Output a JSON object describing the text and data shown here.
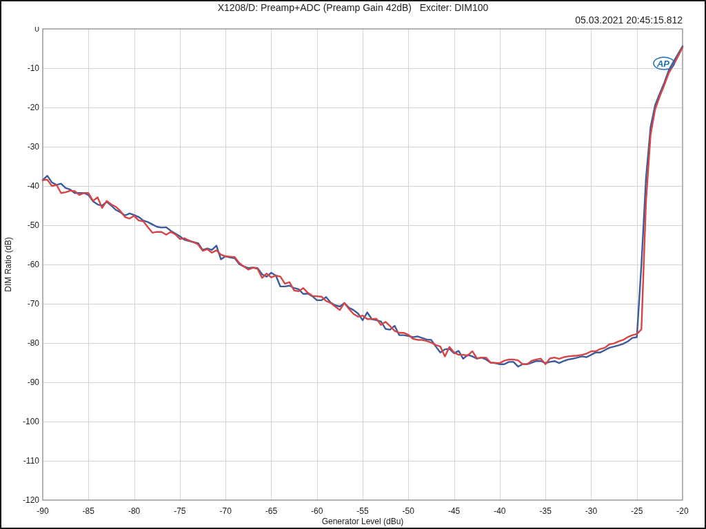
{
  "graph": {
    "timestamp": "05.03.2021 20:45:15.812",
    "logo": "AP",
    "chart_data": {
      "type": "line",
      "grid": true,
      "title": "X1208/D: Preamp+ADC (Preamp Gain 42dB)   Exciter: DIM100",
      "xlabel": "Generator Level (dBu)",
      "ylabel": "DIM Ratio (dB)",
      "x": [
        -90,
        -89.5,
        -89,
        -88.5,
        -88,
        -87.5,
        -87,
        -86.5,
        -86,
        -85.5,
        -85,
        -84.5,
        -84,
        -83.5,
        -83,
        -82.5,
        -82,
        -81.5,
        -81,
        -80.5,
        -80,
        -79.5,
        -79,
        -78.5,
        -78,
        -77.5,
        -77,
        -76.5,
        -76,
        -75.5,
        -75,
        -74.5,
        -74,
        -73.5,
        -73,
        -72.5,
        -72,
        -71.5,
        -71,
        -70.5,
        -70,
        -69.5,
        -69,
        -68.5,
        -68,
        -67.5,
        -67,
        -66.5,
        -66,
        -65.5,
        -65,
        -64.5,
        -64,
        -63.5,
        -63,
        -62.5,
        -62,
        -61.5,
        -61,
        -60.5,
        -60,
        -59.5,
        -59,
        -58.5,
        -58,
        -57.5,
        -57,
        -56.5,
        -56,
        -55.5,
        -55,
        -54.5,
        -54,
        -53.5,
        -53,
        -52.5,
        -52,
        -51.5,
        -51,
        -50.5,
        -50,
        -49.5,
        -49,
        -48.5,
        -48,
        -47.5,
        -47,
        -46.5,
        -46,
        -45.5,
        -45,
        -44.5,
        -44,
        -43.5,
        -43,
        -42.5,
        -42,
        -41.5,
        -41,
        -40.5,
        -40,
        -39.5,
        -39,
        -38.5,
        -38,
        -37.5,
        -37,
        -36.5,
        -36,
        -35.5,
        -35,
        -34.5,
        -34,
        -33.5,
        -33,
        -32.5,
        -32,
        -31.5,
        -31,
        -30.5,
        -30,
        -29.5,
        -29,
        -28.5,
        -28,
        -27.5,
        -27,
        -26.5,
        -26,
        -25.5,
        -25,
        -24.5,
        -24,
        -23.5,
        -23,
        -22.5,
        -22,
        -21.5,
        -21,
        -20.5,
        -20
      ],
      "series": [
        {
          "color": "#3b5b9b",
          "values": [
            -38.5,
            -37.4,
            -39.1,
            -39.7,
            -39.4,
            -40.5,
            -40.9,
            -41.8,
            -41.8,
            -41.8,
            -42.3,
            -43.9,
            -44.7,
            -45.0,
            -44.0,
            -45.0,
            -46.1,
            -46.7,
            -47.5,
            -47.0,
            -47.4,
            -47.9,
            -48.8,
            -49.2,
            -49.8,
            -50.4,
            -50.6,
            -50.5,
            -51.4,
            -52.1,
            -52.8,
            -53.7,
            -54.0,
            -54.3,
            -54.6,
            -56.3,
            -55.9,
            -56.3,
            -55.2,
            -58.7,
            -57.9,
            -58.2,
            -58.4,
            -59.9,
            -60.5,
            -60.9,
            -60.8,
            -60.9,
            -62.5,
            -63.1,
            -62.1,
            -62.8,
            -65.6,
            -65.6,
            -65.4,
            -66.0,
            -66.3,
            -67.5,
            -67.4,
            -68.1,
            -69.1,
            -69.1,
            -68.3,
            -69.7,
            -70.4,
            -70.7,
            -69.8,
            -71.0,
            -71.6,
            -72.5,
            -74.2,
            -72.2,
            -73.9,
            -74.2,
            -74.5,
            -76.4,
            -76.6,
            -75.6,
            -78.0,
            -78.0,
            -78.2,
            -78.5,
            -78.3,
            -78.7,
            -79.1,
            -79.2,
            -80.9,
            -82.4,
            -81.6,
            -81.5,
            -82.6,
            -82.0,
            -84.0,
            -83.0,
            -83.4,
            -84.0,
            -83.7,
            -84.2,
            -85.0,
            -85.1,
            -85.4,
            -85.4,
            -84.8,
            -84.8,
            -86.0,
            -85.4,
            -85.4,
            -85.0,
            -84.6,
            -84.6,
            -85.1,
            -84.8,
            -84.6,
            -85.1,
            -84.6,
            -84.2,
            -84.0,
            -83.7,
            -83.4,
            -83.6,
            -83.0,
            -82.4,
            -82.4,
            -81.8,
            -81.2,
            -80.9,
            -80.6,
            -80.2,
            -79.6,
            -78.7,
            -78.5,
            -60.0,
            -38.0,
            -25.0,
            -19.4,
            -16.5,
            -13.7,
            -10.5,
            -8.4,
            -6.4,
            -4.4
          ]
        },
        {
          "color": "#d64545",
          "values": [
            -38.5,
            -38.4,
            -40.0,
            -39.7,
            -41.8,
            -41.6,
            -41.2,
            -41.3,
            -42.3,
            -41.8,
            -41.8,
            -43.8,
            -42.9,
            -45.6,
            -43.8,
            -44.7,
            -45.3,
            -46.4,
            -47.9,
            -48.3,
            -47.6,
            -48.8,
            -49.0,
            -50.5,
            -51.9,
            -51.7,
            -51.7,
            -52.4,
            -51.7,
            -52.3,
            -53.5,
            -53.3,
            -53.9,
            -54.3,
            -54.9,
            -56.5,
            -56.1,
            -57.0,
            -56.4,
            -57.5,
            -57.9,
            -58.0,
            -58.1,
            -59.6,
            -60.5,
            -61.3,
            -60.8,
            -61.1,
            -63.4,
            -62.3,
            -63.3,
            -62.8,
            -63.1,
            -64.9,
            -64.5,
            -66.6,
            -66.8,
            -66.0,
            -67.2,
            -68.0,
            -68.1,
            -68.2,
            -69.3,
            -69.8,
            -70.7,
            -71.6,
            -69.8,
            -71.3,
            -72.6,
            -73.3,
            -73.0,
            -73.9,
            -73.9,
            -73.8,
            -75.4,
            -74.6,
            -75.7,
            -76.9,
            -77.4,
            -77.4,
            -77.9,
            -78.9,
            -79.2,
            -79.2,
            -79.5,
            -79.9,
            -80.5,
            -80.9,
            -83.4,
            -81.0,
            -82.4,
            -83.0,
            -83.0,
            -83.2,
            -82.1,
            -83.9,
            -83.7,
            -83.7,
            -85.0,
            -85.1,
            -85.1,
            -84.5,
            -84.2,
            -84.2,
            -84.4,
            -85.4,
            -85.4,
            -84.5,
            -84.2,
            -84.0,
            -85.4,
            -83.9,
            -83.7,
            -84.0,
            -83.6,
            -83.4,
            -83.3,
            -83.2,
            -83.0,
            -82.7,
            -82.1,
            -82.1,
            -81.5,
            -81.2,
            -80.3,
            -80.1,
            -79.6,
            -79.2,
            -78.5,
            -78.0,
            -77.7,
            -76.5,
            -44.0,
            -27.0,
            -20.5,
            -17.2,
            -14.3,
            -11.2,
            -9.2,
            -7.0,
            -4.7
          ]
        }
      ],
      "xlim": [
        -90,
        -20
      ],
      "ylim": [
        -120,
        0
      ],
      "xticks": [
        -90,
        -85,
        -80,
        -75,
        -70,
        -65,
        -60,
        -55,
        -50,
        -45,
        -40,
        -35,
        -30,
        -25,
        -20
      ],
      "yticks": [
        0,
        -10,
        -20,
        -30,
        -40,
        -50,
        -60,
        -70,
        -80,
        -90,
        -100,
        -110,
        -120
      ]
    }
  }
}
